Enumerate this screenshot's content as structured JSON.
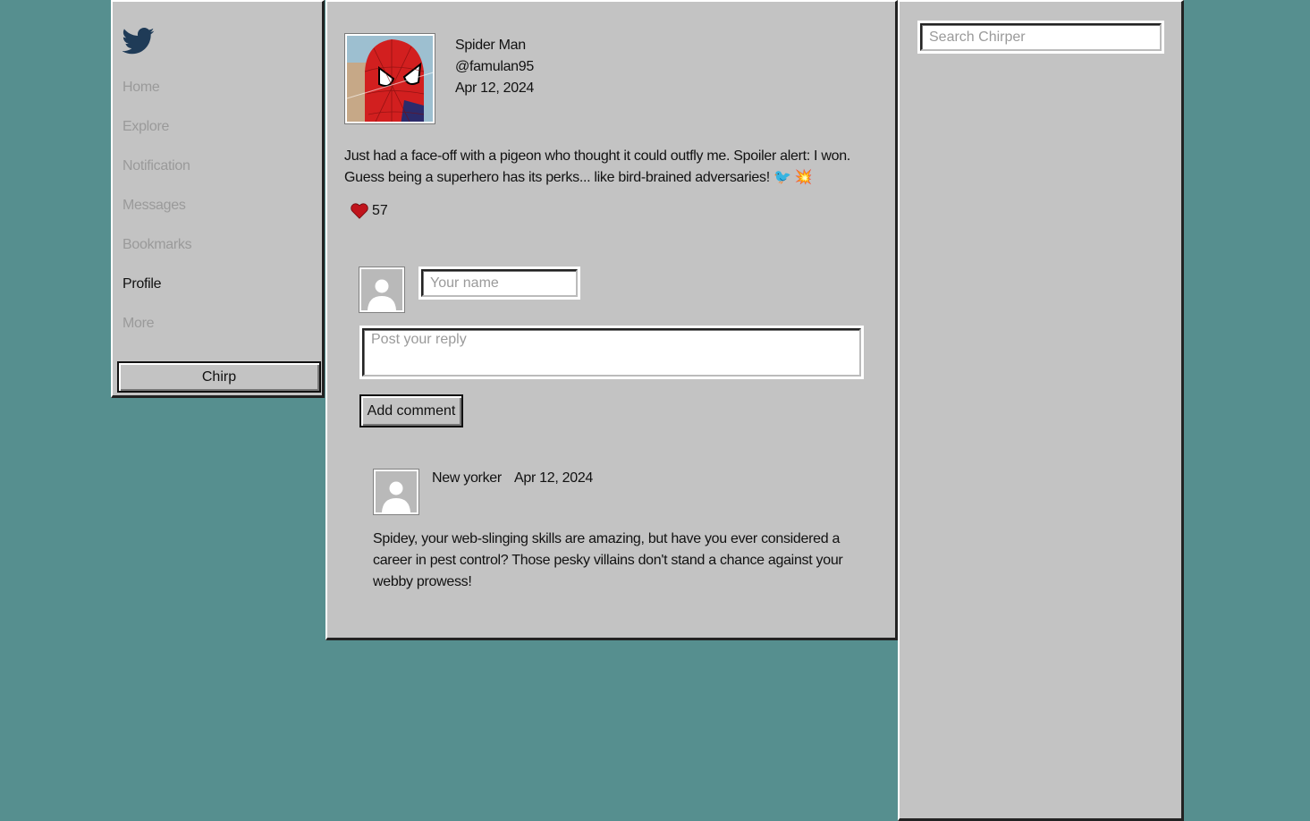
{
  "sidebar": {
    "logo_icon": "bird-icon",
    "nav": [
      {
        "label": "Home",
        "active": false
      },
      {
        "label": "Explore",
        "active": false
      },
      {
        "label": "Notification",
        "active": false
      },
      {
        "label": "Messages",
        "active": false
      },
      {
        "label": "Bookmarks",
        "active": false
      },
      {
        "label": "Profile",
        "active": true
      },
      {
        "label": "More",
        "active": false
      }
    ],
    "chirp_label": "Chirp"
  },
  "post": {
    "author_name": "Spider Man",
    "author_handle": "@famulan95",
    "date": "Apr 12, 2024",
    "text": "Just had a face-off with a pigeon who thought it could outfly me. Spoiler alert: I won. Guess being a superhero has its perks... like bird-brained adversaries! 🐦 💥",
    "likes": "57",
    "like_icon": "heart-icon"
  },
  "reply_form": {
    "name_placeholder": "Your name",
    "reply_placeholder": "Post your reply",
    "submit_label": "Add comment"
  },
  "comments": [
    {
      "author": "New yorker",
      "date": "Apr 12, 2024",
      "text": "Spidey, your web-slinging skills are amazing, but have you ever considered a career in pest control? Those pesky villains don't stand a chance against your webby prowess!"
    }
  ],
  "search": {
    "placeholder": "Search Chirper"
  },
  "colors": {
    "background": "#568f8f",
    "panel": "#c3c3c3",
    "logo": "#1f3b57",
    "heart": "#c0141c"
  }
}
